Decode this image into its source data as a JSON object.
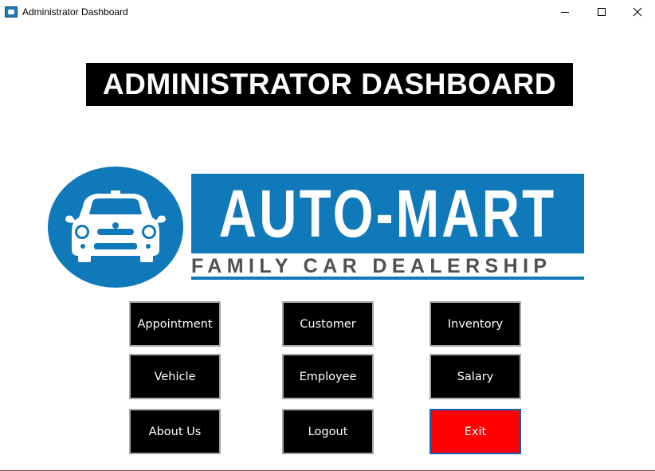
{
  "window": {
    "title": "Administrator Dashboard",
    "controls": [
      "minimize-icon",
      "maximize-icon",
      "close-icon"
    ]
  },
  "heading": {
    "text": "ADMINISTRATOR DASHBOARD"
  },
  "logo": {
    "brand": "AUTO-MART",
    "tagline": "FAMILY CAR DEALERSHIP",
    "icon": "car-front-icon",
    "color": "#0f79ba"
  },
  "buttons": [
    {
      "label": "Appointment",
      "name": "appointment-button"
    },
    {
      "label": "Customer",
      "name": "customer-button"
    },
    {
      "label": "Inventory",
      "name": "inventory-button"
    },
    {
      "label": "Vehicle",
      "name": "vehicle-button"
    },
    {
      "label": "Employee",
      "name": "employee-button"
    },
    {
      "label": "Salary",
      "name": "salary-button"
    },
    {
      "label": "About Us",
      "name": "about-us-button"
    },
    {
      "label": "Logout",
      "name": "logout-button"
    },
    {
      "label": "Exit",
      "name": "exit-button",
      "color": "#ff0000"
    }
  ]
}
